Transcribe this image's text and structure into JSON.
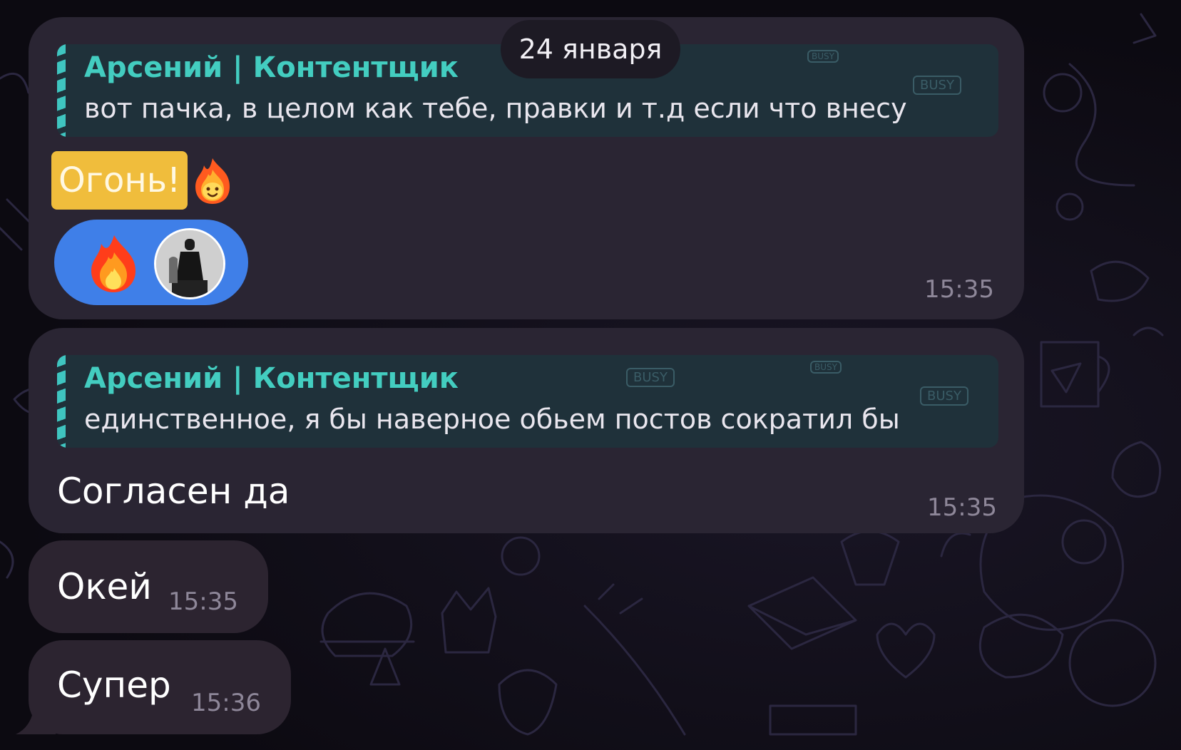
{
  "date_separator": "24 января",
  "messages": [
    {
      "reply": {
        "author": "Арсений | Контентщик",
        "text": "вот пачка, в целом как тебе, правки и т.д если что внесу"
      },
      "text": "Огонь!",
      "emoji": "fire-face",
      "reaction": {
        "emoji": "fire",
        "avatar": "user-avatar"
      },
      "time": "15:35"
    },
    {
      "reply": {
        "author": "Арсений | Контентщик",
        "text": "единственное, я бы наверное обьем постов сократил бы"
      },
      "text": "Согласен да",
      "time": "15:35"
    },
    {
      "text": "Окей",
      "time": "15:35"
    },
    {
      "text": "Супер",
      "time": "15:36"
    }
  ],
  "colors": {
    "bubble": "#2a2533",
    "quote_bg": "#1f313a",
    "quote_accent": "#43cdc0",
    "reaction_bg": "#3f7fe8",
    "highlight": "#f0bd3c"
  }
}
